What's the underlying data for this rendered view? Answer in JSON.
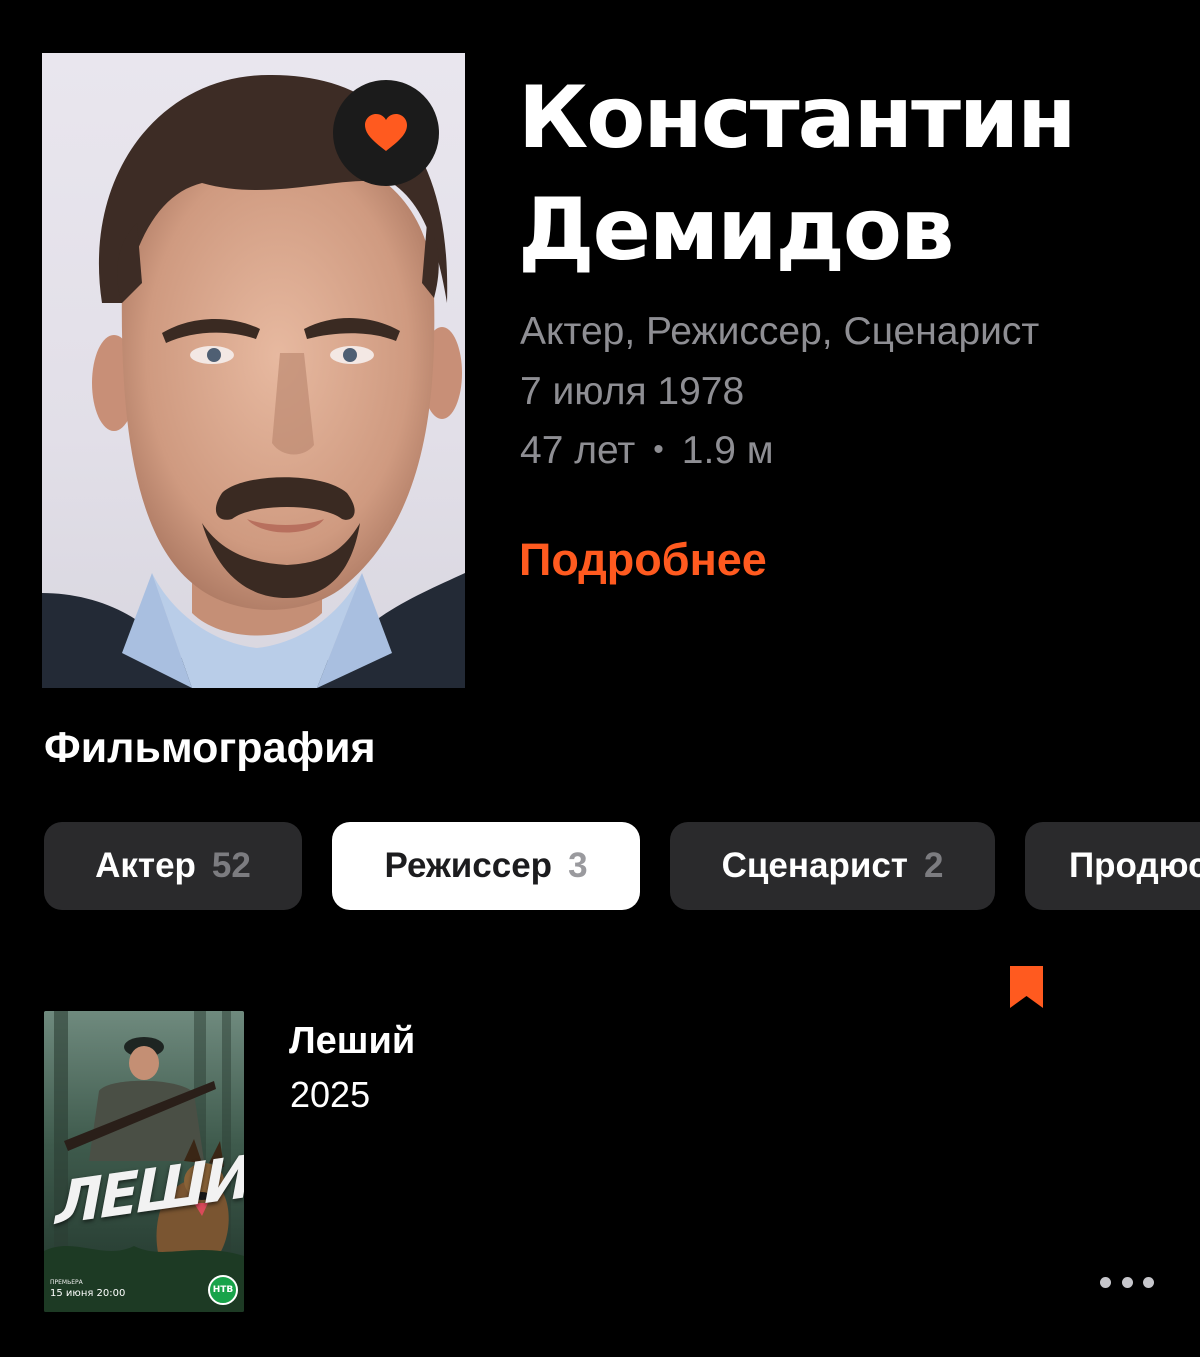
{
  "person": {
    "name_line1": "Константин",
    "name_line2": "Демидов",
    "roles": "Актер, Режиссер, Сценарист",
    "birth_date": "7 июля 1978",
    "age": "47 лет",
    "separator": "•",
    "height": "1.9 м",
    "more_link": "Подробнее",
    "favorite_icon": "heart-icon"
  },
  "filmography": {
    "title": "Фильмография",
    "tabs": [
      {
        "label": "Актер",
        "count": "52",
        "active": false
      },
      {
        "label": "Режиссер",
        "count": "3",
        "active": true
      },
      {
        "label": "Сценарист",
        "count": "2",
        "active": false
      },
      {
        "label": "Продюс",
        "count": "",
        "active": false
      }
    ],
    "items": [
      {
        "title": "Леший",
        "year": "2025",
        "poster_title": "ЛЕШИЙ",
        "poster_premiere": "ПРЕМЬЕРА",
        "poster_date": "15 июня 20:00",
        "poster_logo": "НТВ",
        "bookmark_icon": "bookmark-icon",
        "more_icon": "more-dots-icon"
      }
    ]
  },
  "colors": {
    "background": "#000000",
    "accent": "#ff5a1f",
    "secondary_text": "#8e8e93",
    "tab_bg": "#2a2a2c",
    "tab_active_bg": "#ffffff"
  }
}
